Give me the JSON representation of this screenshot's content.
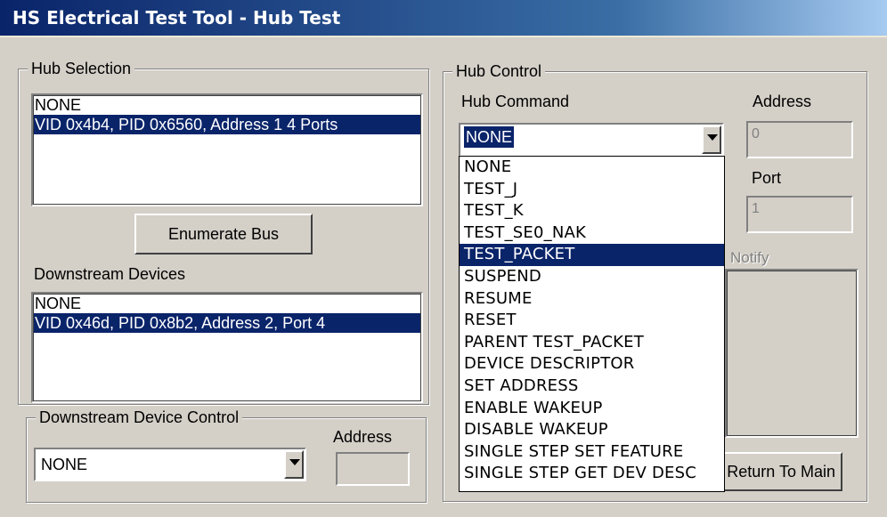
{
  "window": {
    "title": "HS Electrical Test Tool - Hub Test"
  },
  "hub_selection": {
    "label": "Hub Selection",
    "items": [
      {
        "text": "NONE",
        "selected": false
      },
      {
        "text": "VID 0x4b4, PID 0x6560, Address 1  4 Ports",
        "selected": true
      }
    ],
    "enumerate_button": "Enumerate Bus",
    "downstream_label": "Downstream Devices",
    "downstream_items": [
      {
        "text": "NONE",
        "selected": false
      },
      {
        "text": "VID 0x46d, PID 0x8b2, Address 2, Port 4",
        "selected": true
      }
    ]
  },
  "downstream_device_control": {
    "label": "Downstream Device Control",
    "address_label": "Address",
    "combo_value": "NONE",
    "address_value": ""
  },
  "hub_control": {
    "label": "Hub Control",
    "command_label": "Hub Command",
    "command_value": "NONE",
    "address_label": "Address",
    "address_value": "0",
    "port_label": "Port",
    "port_value": "1",
    "notify_label": "Notify",
    "return_button": "Return To Main",
    "dropdown_options": [
      "NONE",
      "TEST_J",
      "TEST_K",
      "TEST_SE0_NAK",
      "TEST_PACKET",
      "SUSPEND",
      "RESUME",
      "RESET",
      "PARENT TEST_PACKET",
      "DEVICE DESCRIPTOR",
      "SET ADDRESS",
      "ENABLE WAKEUP",
      "DISABLE WAKEUP",
      "SINGLE STEP SET FEATURE",
      "SINGLE STEP GET DEV DESC"
    ],
    "dropdown_highlighted": "TEST_PACKET"
  },
  "colors": {
    "selection": "#0a246a",
    "face": "#d4d0c8",
    "title_gradient_start": "#0a246a",
    "title_gradient_end": "#a6caf0"
  }
}
